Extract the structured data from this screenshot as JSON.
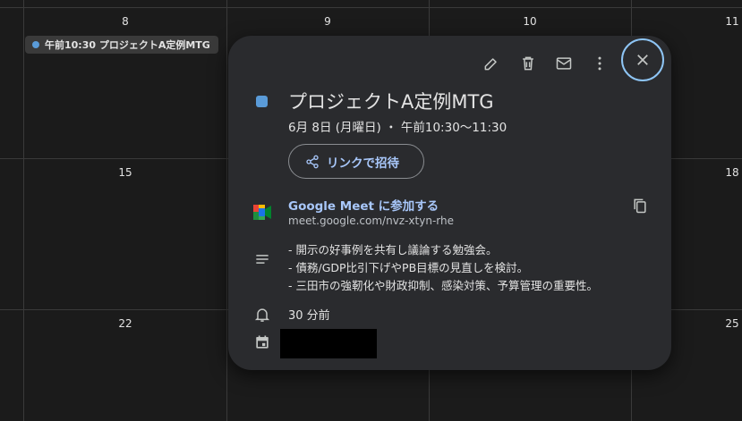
{
  "calendar": {
    "day_numbers": [
      "8",
      "9",
      "10",
      "11",
      "15",
      "18",
      "22",
      "25"
    ],
    "event_chip": "午前10:30 プロジェクトA定例MTG"
  },
  "popup": {
    "title": "プロジェクトA定例MTG",
    "date": "6月 8日 (月曜日)  ・  午前10:30～11:30",
    "invite_label": "リンクで招待",
    "meet_label": "Google Meet に参加する",
    "meet_url": "meet.google.com/nvz-xtyn-rhe",
    "description": [
      "- 開示の好事例を共有し議論する勉強会。",
      "- 債務/GDP比引下げやPB目標の見直しを検討。",
      "- 三田市の強靭化や財政抑制、感染対策、予算管理の重要性。"
    ],
    "reminder": "30 分前",
    "accent_color": "#5a9bd8",
    "link_color": "#a8c7fa"
  }
}
